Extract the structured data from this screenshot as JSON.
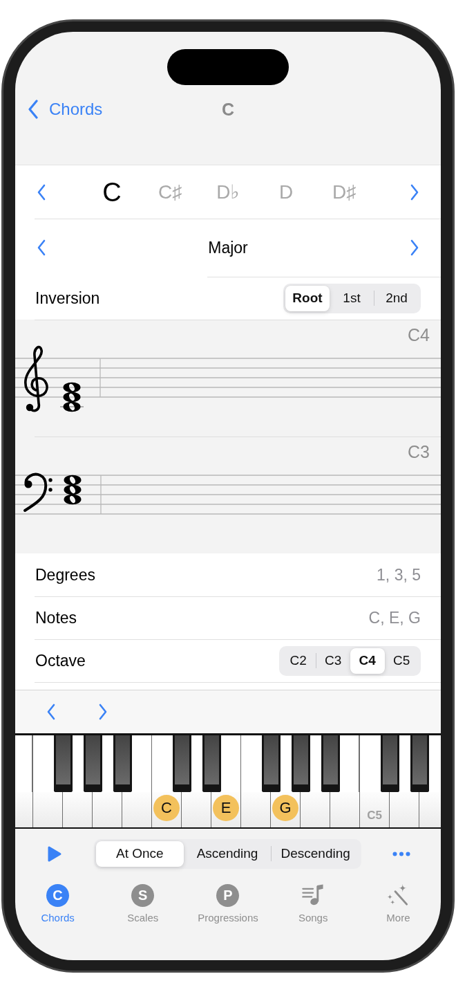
{
  "nav": {
    "back_label": "Chords",
    "title": "C"
  },
  "root_picker": {
    "notes": [
      {
        "label": "C",
        "selected": true
      },
      {
        "label": "C♯",
        "selected": false
      },
      {
        "label": "D♭",
        "selected": false
      },
      {
        "label": "D",
        "selected": false
      },
      {
        "label": "D♯",
        "selected": false
      }
    ]
  },
  "chord_type": {
    "label": "Major"
  },
  "inversion": {
    "label": "Inversion",
    "options": [
      {
        "label": "Root",
        "selected": true
      },
      {
        "label": "1st",
        "selected": false
      },
      {
        "label": "2nd",
        "selected": false
      }
    ]
  },
  "staves": [
    {
      "kind": "treble",
      "octave_label": "C4"
    },
    {
      "kind": "bass",
      "octave_label": "C3"
    }
  ],
  "info_rows": [
    {
      "kind": "value",
      "label": "Degrees",
      "value": "1, 3, 5"
    },
    {
      "kind": "value",
      "label": "Notes",
      "value": "C, E, G"
    },
    {
      "kind": "segmented",
      "label": "Octave",
      "options": [
        {
          "label": "C2",
          "selected": false
        },
        {
          "label": "C3",
          "selected": false
        },
        {
          "label": "C4",
          "selected": true
        },
        {
          "label": "C5",
          "selected": false
        }
      ]
    }
  ],
  "piano": {
    "white_keys": [
      {
        "black_key_right": false,
        "marked": false
      },
      {
        "black_key_right": true,
        "marked": false
      },
      {
        "black_key_right": true,
        "marked": false
      },
      {
        "black_key_right": true,
        "marked": false
      },
      {
        "black_key_right": false,
        "marked": false
      },
      {
        "black_key_right": true,
        "marked": true,
        "label": "C"
      },
      {
        "black_key_right": true,
        "marked": false
      },
      {
        "black_key_right": false,
        "marked": true,
        "label": "E"
      },
      {
        "black_key_right": true,
        "marked": false
      },
      {
        "black_key_right": true,
        "marked": true,
        "label": "G"
      },
      {
        "black_key_right": true,
        "marked": false
      },
      {
        "black_key_right": false,
        "marked": false
      },
      {
        "black_key_right": true,
        "marked": false,
        "label": "C5"
      },
      {
        "black_key_right": true,
        "marked": false
      },
      {
        "black_key_right": false,
        "marked": false
      }
    ]
  },
  "playback": {
    "modes": [
      {
        "label": "At Once",
        "selected": true
      },
      {
        "label": "Ascending",
        "selected": false
      },
      {
        "label": "Descending",
        "selected": false
      }
    ]
  },
  "tab_bar": {
    "tabs": [
      {
        "kind": "letter",
        "letter": "C",
        "label": "Chords",
        "selected": true
      },
      {
        "kind": "letter",
        "letter": "S",
        "label": "Scales",
        "selected": false
      },
      {
        "kind": "letter",
        "letter": "P",
        "label": "Progressions",
        "selected": false
      },
      {
        "kind": "songs",
        "label": "Songs",
        "selected": false
      },
      {
        "kind": "more",
        "label": "More",
        "selected": false
      }
    ]
  }
}
